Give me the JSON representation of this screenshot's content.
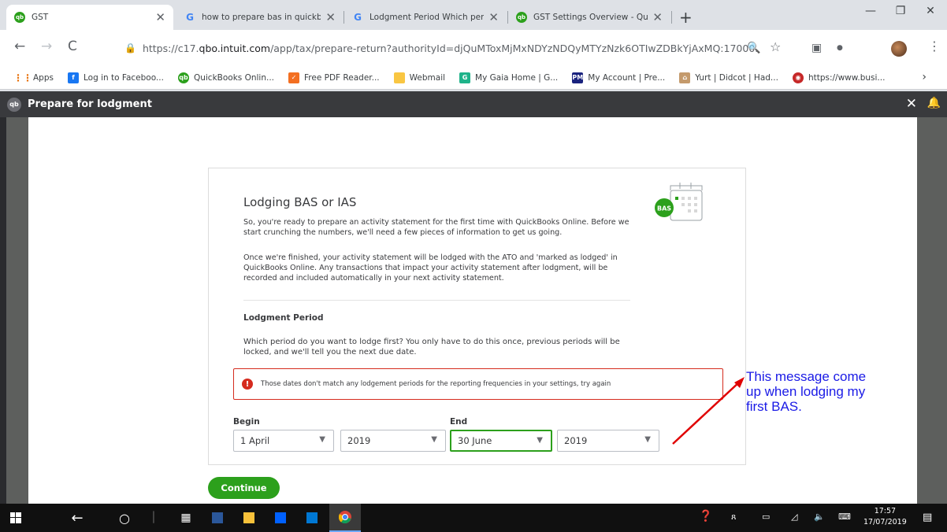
{
  "browser": {
    "tabs": [
      {
        "title": "GST",
        "favicon": "quickbooks-icon"
      },
      {
        "title": "how to prepare bas in quickbo",
        "favicon": "google-icon"
      },
      {
        "title": "Lodgment Period Which perio",
        "favicon": "google-icon"
      },
      {
        "title": "GST Settings Overview - Quick",
        "favicon": "quickbooks-icon"
      }
    ],
    "url_prefix": "https://c17.",
    "url_domain": "qbo.intuit.com",
    "url_rest": "/app/tax/prepare-return?authorityId=djQuMToxMjMxNDYzNDQyMTYzNzk6OTIwZDBkYjAxMQ:17000...",
    "bookmarks": [
      {
        "label": "Apps",
        "icon": "apps-grid-icon",
        "color": "#e8710a"
      },
      {
        "label": "Log in to Faceboo...",
        "icon": "facebook-icon",
        "color": "#1877f2"
      },
      {
        "label": "QuickBooks Onlin...",
        "icon": "quickbooks-icon",
        "color": "#2ca01c"
      },
      {
        "label": "Free PDF Reader...",
        "icon": "pdf-reader-icon",
        "color": "#f36f21"
      },
      {
        "label": "Webmail",
        "icon": "folder-icon",
        "color": "#f9c642"
      },
      {
        "label": "My Gaia Home | G...",
        "icon": "gaia-icon",
        "color": "#1fb38a"
      },
      {
        "label": "My Account | Pre...",
        "icon": "pm-icon",
        "color": "#1a237e"
      },
      {
        "label": "Yurt | Didcot | Had...",
        "icon": "yurt-icon",
        "color": "#c49a6c"
      },
      {
        "label": "https://www.busi...",
        "icon": "business-icon",
        "color": "#c62828"
      }
    ]
  },
  "app": {
    "title": "Prepare for lodgment",
    "logo_text": "qb"
  },
  "card": {
    "title": "Lodging BAS or IAS",
    "para1": "So, you're ready to prepare an activity statement for the first time with QuickBooks Online. Before we start crunching the numbers, we'll need a few pieces of information to get us going.",
    "para2": "Once we're finished, your activity statement will be lodged with the ATO and 'marked as lodged' in QuickBooks Online. Any transactions that impact your activity statement after lodgment, will be recorded and included automatically in your next activity statement.",
    "section_title": "Lodgment Period",
    "para3": "Which period do you want to lodge first? You only have to do this once, previous periods will be locked, and we'll tell you the next due date.",
    "bas_badge": "BAS",
    "error": "Those dates don't match any lodgement periods for the reporting frequencies in your settings, try again",
    "begin_label": "Begin",
    "end_label": "End",
    "begin_month": "1 April",
    "begin_year": "2019",
    "end_month": "30 June",
    "end_year": "2019",
    "continue_label": "Continue"
  },
  "annotation": {
    "text": "This message come up when lodging my first BAS.",
    "color": "#1a1ae6",
    "arrow_color": "#e00000"
  },
  "taskbar": {
    "time": "17:57",
    "date": "17/07/2019"
  }
}
